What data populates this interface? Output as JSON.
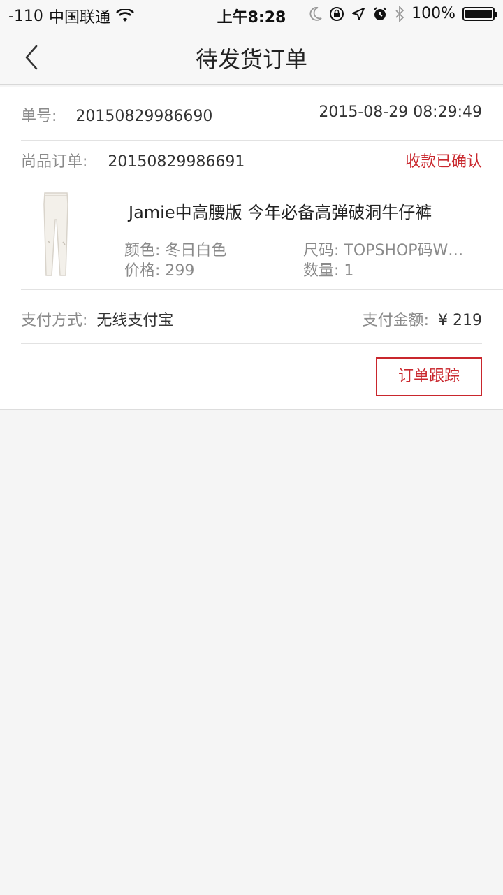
{
  "status_bar": {
    "signal": "-110",
    "carrier": "中国联通",
    "time": "上午8:28",
    "battery": "100%"
  },
  "nav": {
    "title": "待发货订单"
  },
  "order": {
    "number_label": "单号:",
    "number": "20150829986690",
    "datetime": "2015-08-29 08:29:49",
    "sub_label": "尚品订单:",
    "sub_number": "20150829986691",
    "status": "收款已确认"
  },
  "product": {
    "title": "Jamie中高腰版 今年必备高弹破洞牛仔裤",
    "color_label": "颜色:",
    "color": "冬日白色",
    "size_label": "尺码:",
    "size": "TOPSHOP码W…",
    "price_label": "价格:",
    "price": "299",
    "qty_label": "数量:",
    "qty": "1"
  },
  "payment": {
    "method_label": "支付方式:",
    "method": "无线支付宝",
    "amount_label": "支付金额:",
    "amount": "¥ 219"
  },
  "actions": {
    "track_label": "订单跟踪"
  },
  "colors": {
    "accent": "#c9272d",
    "background": "#f5f5f5"
  }
}
